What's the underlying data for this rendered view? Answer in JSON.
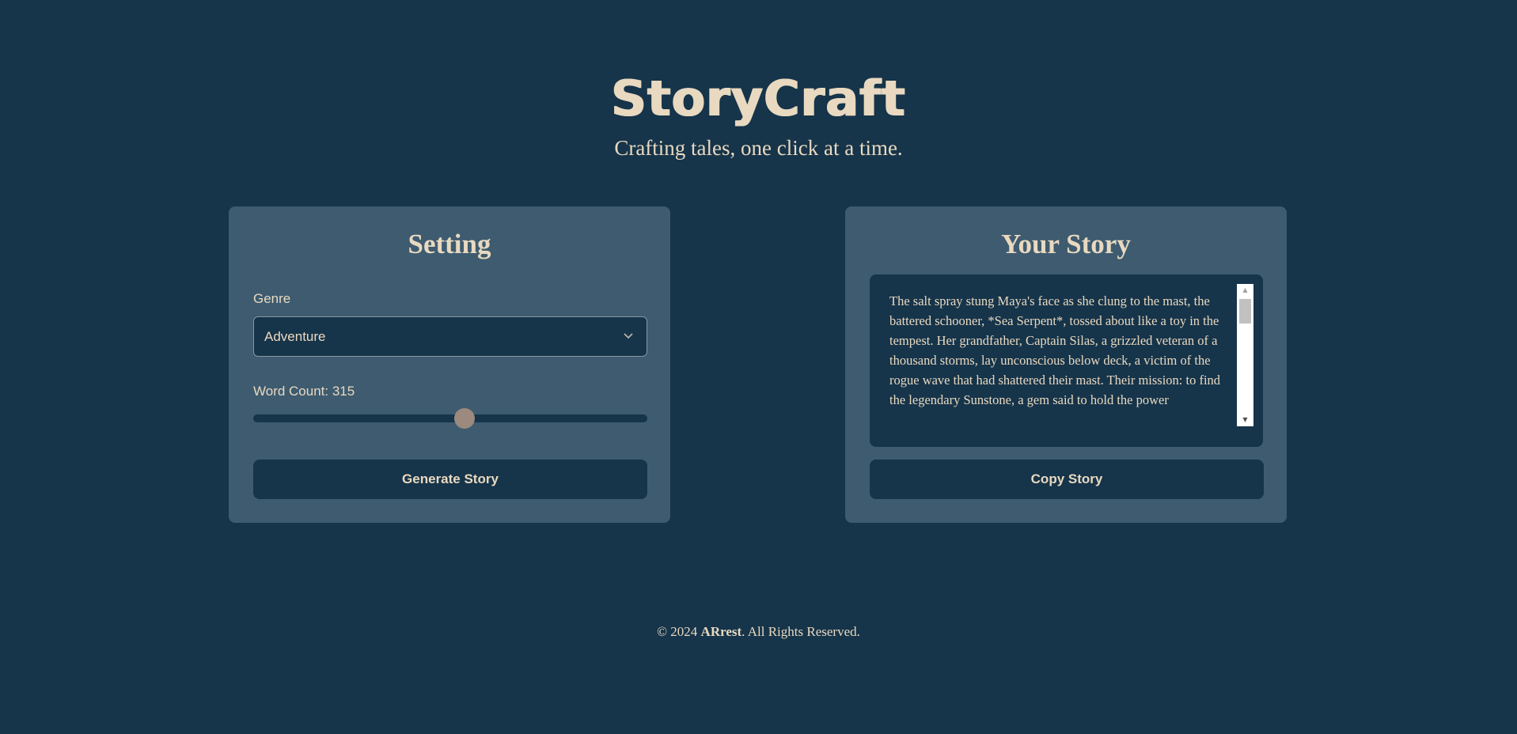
{
  "header": {
    "title": "StoryCraft",
    "subtitle": "Crafting tales, one click at a time."
  },
  "setting_panel": {
    "title": "Setting",
    "genre_label": "Genre",
    "genre_value": "Adventure",
    "word_count_label": "Word Count: 315",
    "word_count": 315,
    "slider_fraction": 0.537,
    "generate_button": "Generate Story"
  },
  "story_panel": {
    "title": "Your Story",
    "story_text": "The salt spray stung Maya's face as she clung to the mast, the battered schooner, *Sea Serpent*, tossed about like a toy in the tempest. Her grandfather, Captain Silas, a grizzled veteran of a thousand storms, lay unconscious below deck, a victim of the rogue wave that had shattered their mast. Their mission: to find the legendary Sunstone, a gem said to hold the power",
    "copy_button": "Copy Story"
  },
  "footer": {
    "prefix": "© 2024 ",
    "brand": "ARrest",
    "suffix": ". All Rights Reserved."
  },
  "icons": {
    "select_chevron": "chevron-down-icon",
    "scroll_up": "scroll-up-arrow-icon",
    "scroll_down": "scroll-down-arrow-icon"
  },
  "colors": {
    "background": "#16344a",
    "card": "#3e5b70",
    "text": "#e8d9c0",
    "slider_thumb": "#9b8a7d"
  }
}
